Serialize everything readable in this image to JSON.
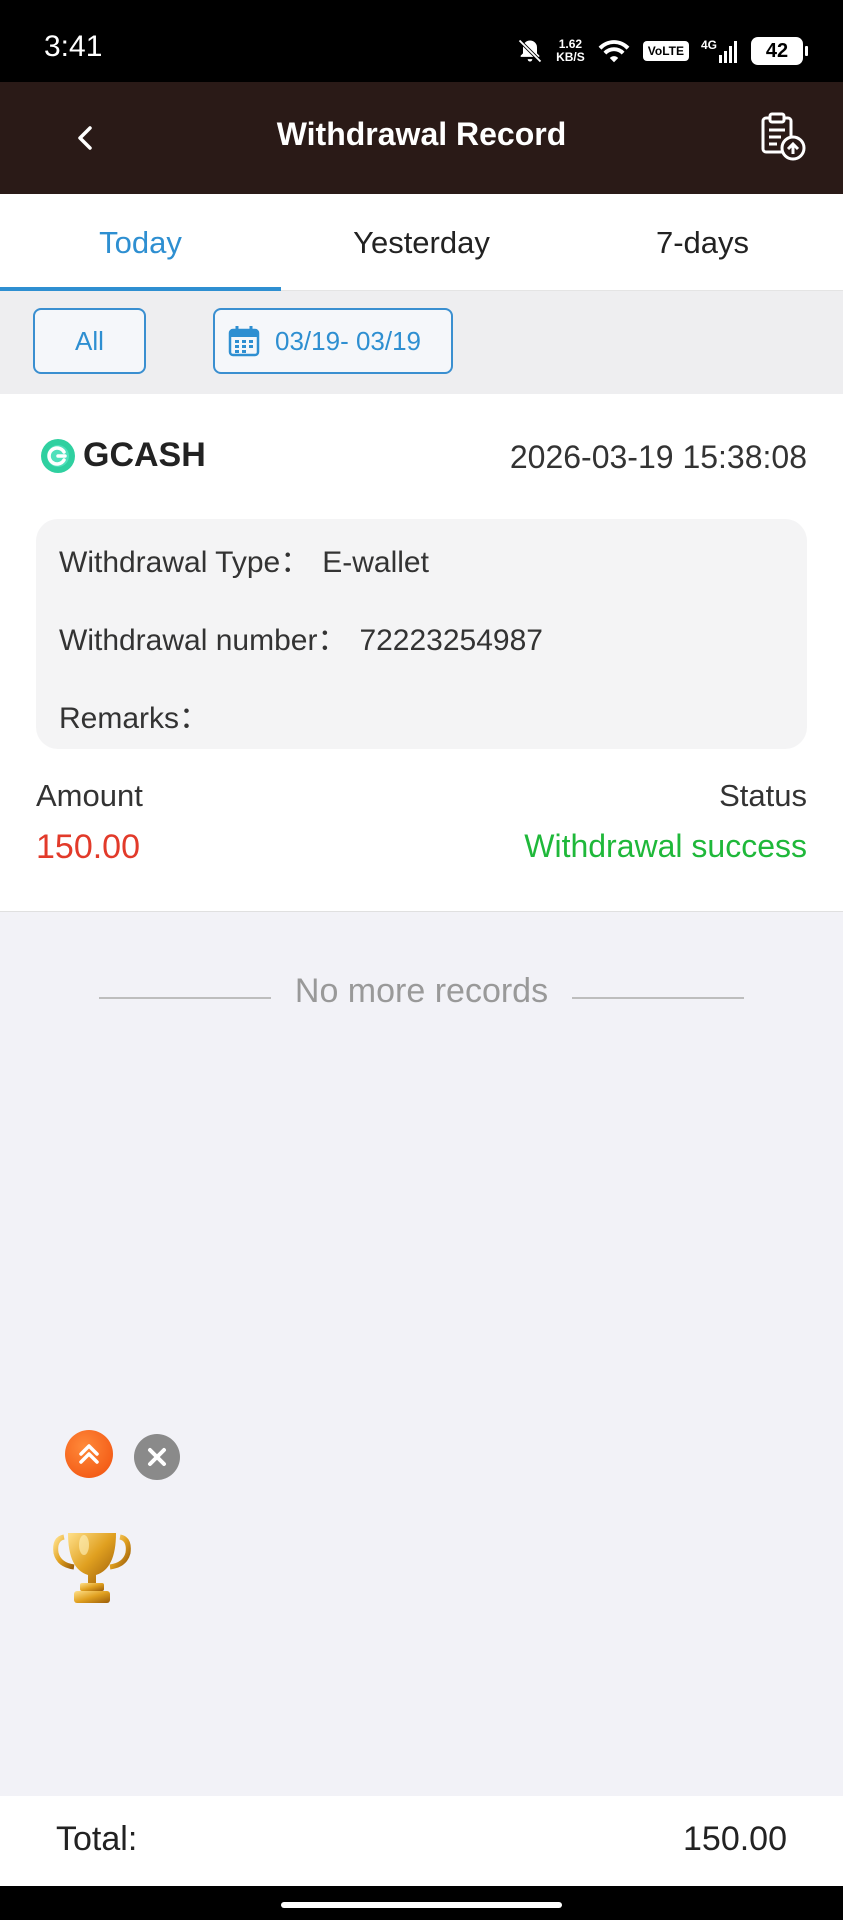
{
  "status_bar": {
    "time": "3:41",
    "net_speed_value": "1.62",
    "net_speed_unit": "KB/S",
    "volte": "VoLTE",
    "network": "4G",
    "battery": "42"
  },
  "header": {
    "title": "Withdrawal Record",
    "icons": [
      "back-arrow-icon",
      "export-record-icon"
    ]
  },
  "tabs": [
    {
      "label": "Today",
      "active": true
    },
    {
      "label": "Yesterday",
      "active": false
    },
    {
      "label": "7-days",
      "active": false
    }
  ],
  "filter": {
    "type_button": "All",
    "date_range": "03/19- 03/19"
  },
  "record": {
    "provider": "GCASH",
    "datetime": "2026-03-19 15:38:08",
    "type_label": "Withdrawal Type：",
    "type_value": "E-wallet",
    "number_label": "Withdrawal number：",
    "number_value": "72223254987",
    "remarks_label": "Remarks：",
    "remarks_value": "",
    "amount_label": "Amount",
    "amount_value": "150.00",
    "status_label": "Status",
    "status_value": "Withdrawal success"
  },
  "no_more": "No more records",
  "footer": {
    "total_label": "Total:",
    "total_value": "150.00"
  },
  "colors": {
    "header_bg": "#2a1a17",
    "accent": "#2e8fd1",
    "amount": "#e23a2a",
    "success": "#1fb83a"
  }
}
